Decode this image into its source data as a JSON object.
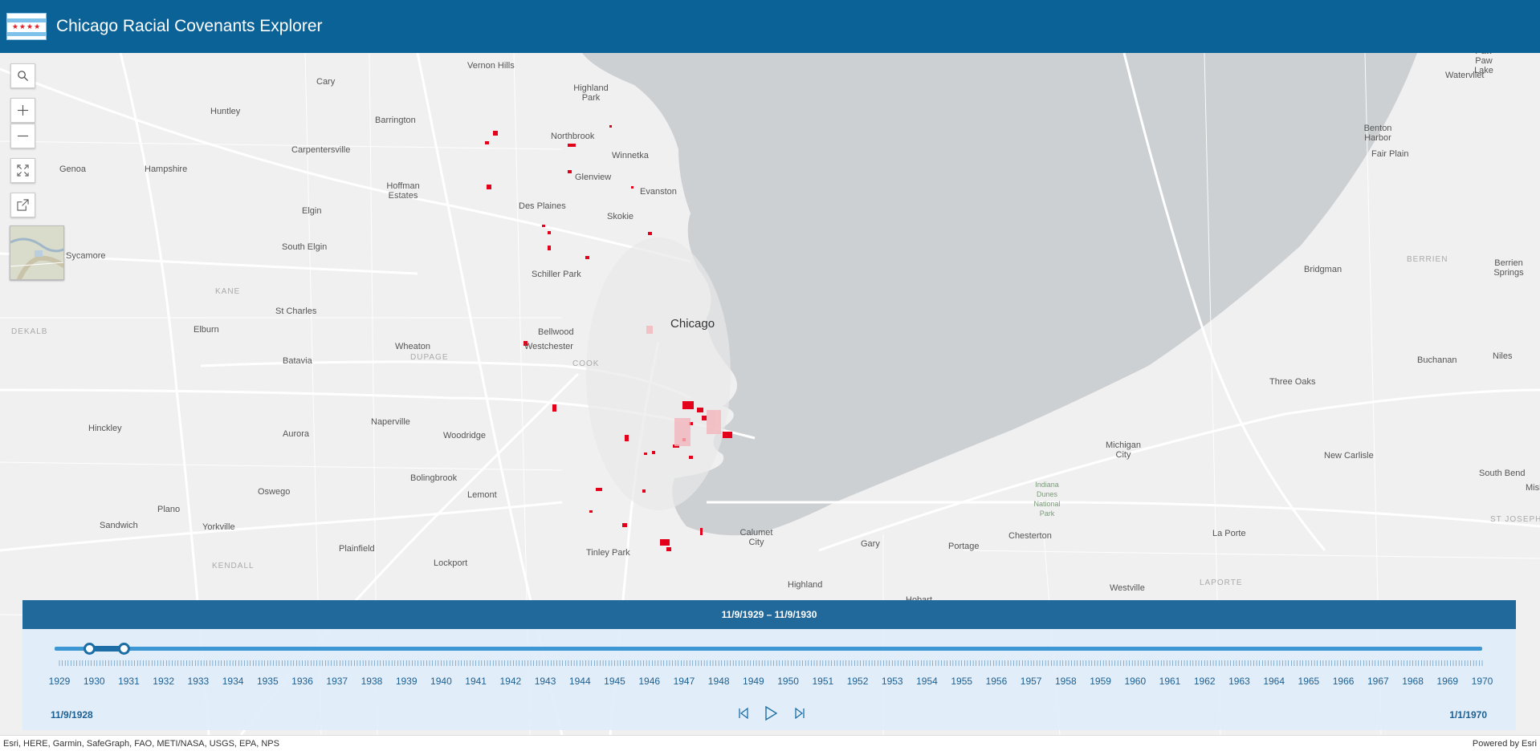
{
  "header": {
    "title": "Chicago Racial Covenants Explorer",
    "flag_stars": "★★★★"
  },
  "colors": {
    "header": "#0b6297",
    "lake": "#ccd0d3",
    "covenant": "#e3001b",
    "slider_accent": "#1d6ea6"
  },
  "controls": [
    "search-icon",
    "zoom-in-icon",
    "zoom-out-icon",
    "fullscreen-icon",
    "share-icon"
  ],
  "map_labels": [
    {
      "text": "Vernon Hills"
    },
    {
      "text": "Highland Park"
    },
    {
      "text": "Cary"
    },
    {
      "text": "Huntley"
    },
    {
      "text": "Barrington"
    },
    {
      "text": "Northbrook"
    },
    {
      "text": "Winnetka"
    },
    {
      "text": "Carpentersville"
    },
    {
      "text": "Glenview"
    },
    {
      "text": "Evanston"
    },
    {
      "text": "Genoa"
    },
    {
      "text": "Hampshire"
    },
    {
      "text": "Hoffman Estates"
    },
    {
      "text": "Des Plaines"
    },
    {
      "text": "Skokie"
    },
    {
      "text": "Elgin"
    },
    {
      "text": "South Elgin"
    },
    {
      "text": "Sycamore"
    },
    {
      "text": "Schiller Park"
    },
    {
      "text": "KANE"
    },
    {
      "text": "St Charles"
    },
    {
      "text": "Chicago"
    },
    {
      "text": "Bellwood"
    },
    {
      "text": "Westchester"
    },
    {
      "text": "DEKALB"
    },
    {
      "text": "Elburn"
    },
    {
      "text": "Wheaton"
    },
    {
      "text": "DUPAGE"
    },
    {
      "text": "COOK"
    },
    {
      "text": "Batavia"
    },
    {
      "text": "Naperville"
    },
    {
      "text": "Hinckley"
    },
    {
      "text": "Aurora"
    },
    {
      "text": "Woodridge"
    },
    {
      "text": "Bolingbrook"
    },
    {
      "text": "Oswego"
    },
    {
      "text": "Lemont"
    },
    {
      "text": "Plano"
    },
    {
      "text": "Sandwich"
    },
    {
      "text": "Yorkville"
    },
    {
      "text": "Plainfield"
    },
    {
      "text": "Tinley Park"
    },
    {
      "text": "Calumet City"
    },
    {
      "text": "Lockport"
    },
    {
      "text": "KENDALL"
    },
    {
      "text": "Gary"
    },
    {
      "text": "Portage"
    },
    {
      "text": "Chesterton"
    },
    {
      "text": "Highland"
    },
    {
      "text": "Hobart"
    },
    {
      "text": "Westville"
    },
    {
      "text": "La Porte"
    },
    {
      "text": "LAPORTE"
    },
    {
      "text": "Michigan City"
    },
    {
      "text": "Indiana Dunes National Park"
    },
    {
      "text": "New Carlisle"
    },
    {
      "text": "Three Oaks"
    },
    {
      "text": "Bridgman"
    },
    {
      "text": "Buchanan"
    },
    {
      "text": "Niles"
    },
    {
      "text": "South Bend"
    },
    {
      "text": "Mishawaka"
    },
    {
      "text": "ST JOSEPH"
    },
    {
      "text": "Benton Harbor"
    },
    {
      "text": "Fair Plain"
    },
    {
      "text": "Berrien Springs"
    },
    {
      "text": "BERRIEN"
    },
    {
      "text": "Paw Paw Lake"
    },
    {
      "text": "Watervliet"
    }
  ],
  "time_slider": {
    "current_range": "11/9/1929  –  11/9/1930",
    "start_label": "11/9/1928",
    "end_label": "1/1/1970",
    "years": [
      "1929",
      "1930",
      "1931",
      "1932",
      "1933",
      "1934",
      "1935",
      "1936",
      "1937",
      "1938",
      "1939",
      "1940",
      "1941",
      "1942",
      "1943",
      "1944",
      "1945",
      "1946",
      "1947",
      "1948",
      "1949",
      "1950",
      "1951",
      "1952",
      "1953",
      "1954",
      "1955",
      "1956",
      "1957",
      "1958",
      "1959",
      "1960",
      "1961",
      "1962",
      "1963",
      "1964",
      "1965",
      "1966",
      "1967",
      "1968",
      "1969",
      "1970"
    ],
    "thumb_start_year": 1929.86,
    "thumb_end_year": 1930.86,
    "domain": [
      1928.86,
      1970.0
    ]
  },
  "attribution": {
    "left": "Esri, HERE, Garmin, SafeGraph, FAO, METI/NASA, USGS, EPA, NPS",
    "right": "Powered by Esri"
  }
}
